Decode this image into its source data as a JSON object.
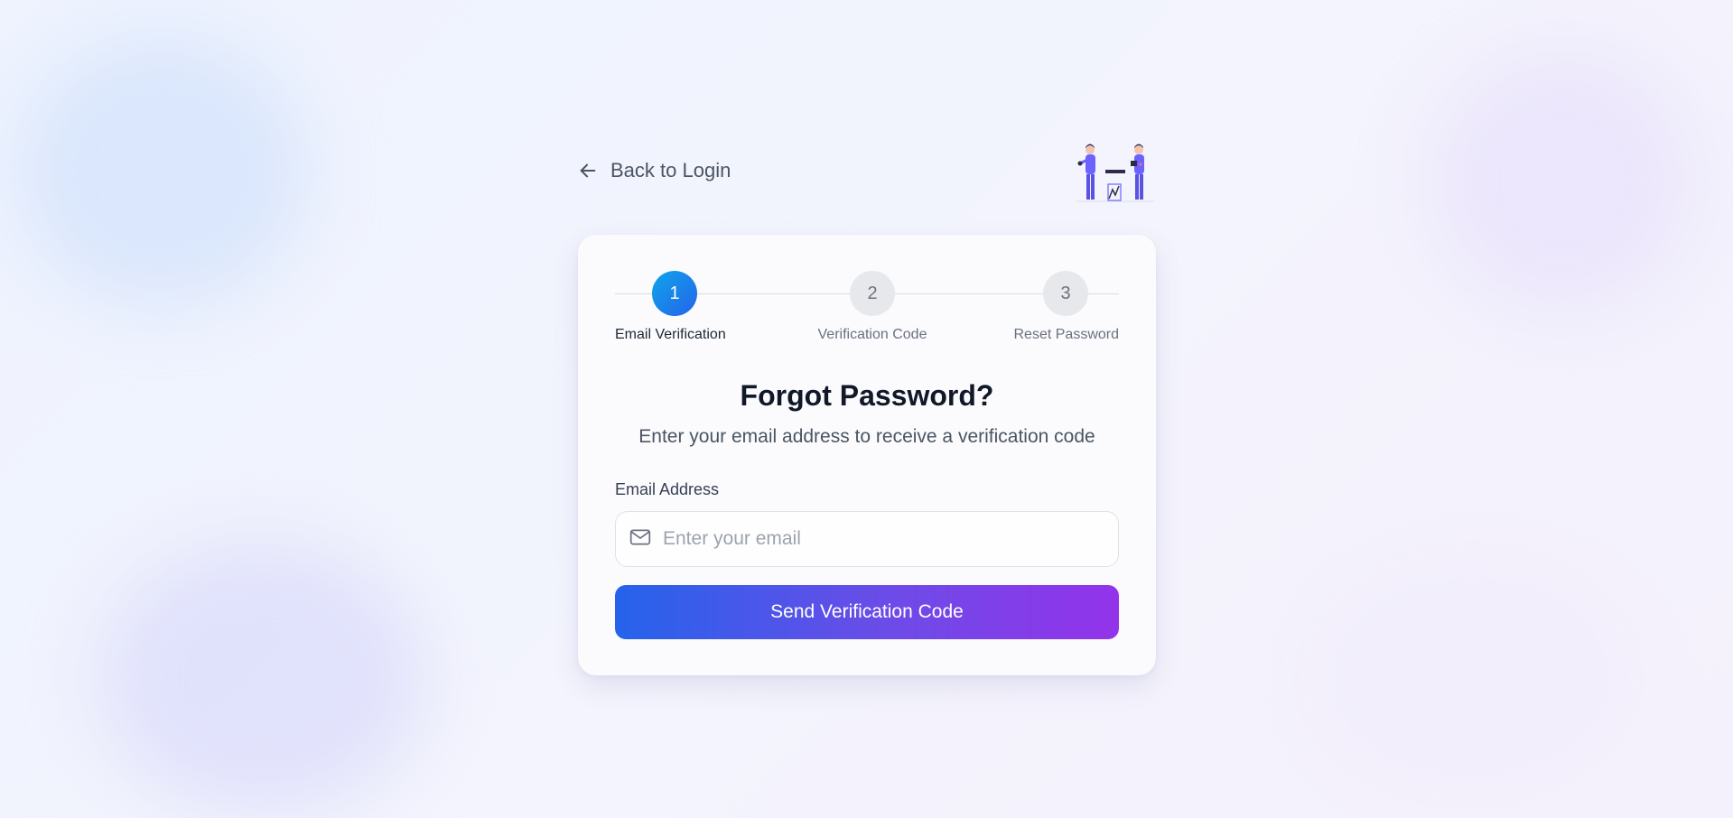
{
  "header": {
    "back_label": "Back to Login",
    "back_icon": "arrow-left-icon",
    "illustration": "team-illustration"
  },
  "stepper": {
    "current_step": 1,
    "steps": [
      {
        "number": "1",
        "label": "Email Verification",
        "state": "active"
      },
      {
        "number": "2",
        "label": "Verification Code",
        "state": "inactive"
      },
      {
        "number": "3",
        "label": "Reset Password",
        "state": "inactive"
      }
    ]
  },
  "form": {
    "title": "Forgot Password?",
    "subtitle": "Enter your email address to receive a verification code",
    "email_label": "Email Address",
    "email_placeholder": "Enter your email",
    "email_value": "",
    "email_icon": "mail-icon",
    "submit_label": "Send Verification Code"
  },
  "colors": {
    "active_step_gradient": [
      "#0ea5e9",
      "#2563eb"
    ],
    "button_gradient": [
      "#2563eb",
      "#9333ea"
    ],
    "inactive_step_bg": "#e7e8eb"
  }
}
